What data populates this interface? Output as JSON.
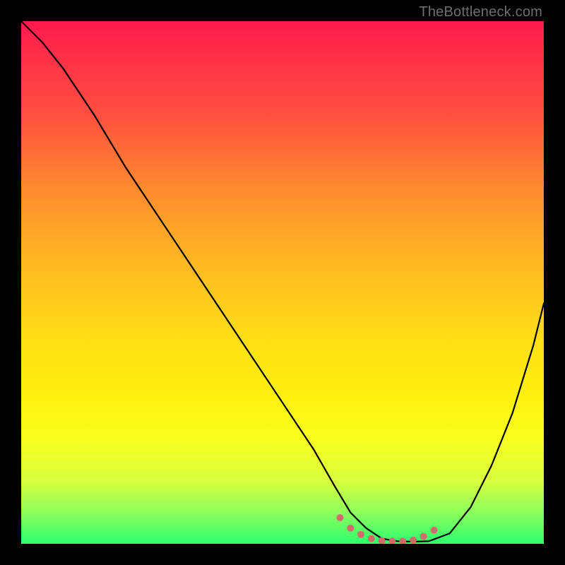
{
  "watermark": "TheBottleneck.com",
  "chart_data": {
    "type": "line",
    "title": "",
    "xlabel": "",
    "ylabel": "",
    "xlim": [
      0,
      100
    ],
    "ylim": [
      0,
      100
    ],
    "series": [
      {
        "name": "curve",
        "color": "#000000",
        "x": [
          0,
          4,
          8,
          14,
          20,
          26,
          32,
          38,
          44,
          50,
          56,
          60,
          63,
          66,
          69,
          72,
          75,
          78,
          82,
          86,
          90,
          94,
          98,
          100
        ],
        "values": [
          100,
          96,
          91,
          82,
          72,
          63,
          54,
          45,
          36,
          27,
          18,
          11,
          6,
          3,
          1,
          0.5,
          0.4,
          0.5,
          2,
          7,
          15,
          25,
          38,
          46
        ]
      }
    ],
    "marker_region": {
      "color": "#d46a6a",
      "radius": 5,
      "x": [
        61,
        63,
        65,
        67,
        69,
        71,
        73,
        75,
        77,
        79
      ],
      "values": [
        5,
        3,
        1.8,
        1.0,
        0.6,
        0.5,
        0.5,
        0.7,
        1.4,
        2.6
      ]
    },
    "gradient_stops": [
      {
        "pos": 0.0,
        "color": "#ff1a4d"
      },
      {
        "pos": 0.3,
        "color": "#ff8232"
      },
      {
        "pos": 0.6,
        "color": "#ffe114"
      },
      {
        "pos": 0.85,
        "color": "#d8ff3c"
      },
      {
        "pos": 1.0,
        "color": "#2bff6e"
      }
    ]
  }
}
